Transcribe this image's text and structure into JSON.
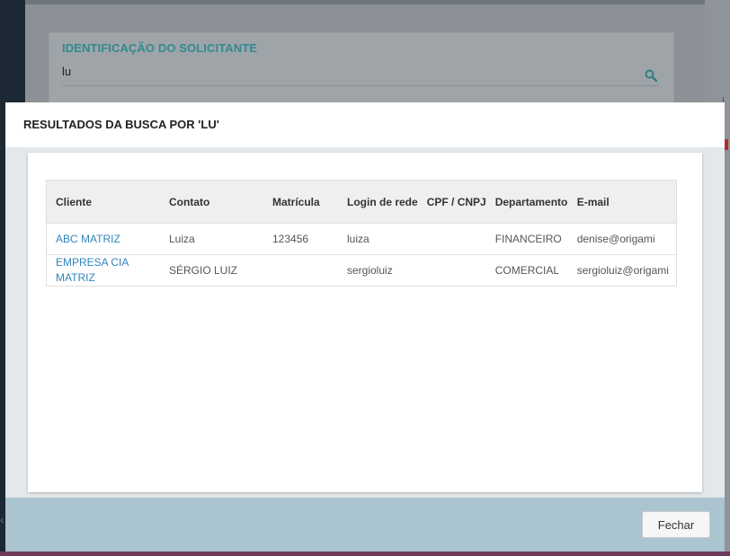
{
  "background_form": {
    "section_title": "IDENTIFICAÇÃO DO SOLICITANTE",
    "search_value": "lu",
    "search_icon": "search-icon"
  },
  "modal": {
    "title": "RESULTADOS DA BUSCA POR 'LU'",
    "columns": [
      "Cliente",
      "Contato",
      "Matrícula",
      "Login de rede",
      "CPF / CNPJ",
      "Departamento",
      "E-mail"
    ],
    "rows": [
      {
        "cliente": "ABC MATRIZ",
        "contato": "Luiza",
        "matricula": "123456",
        "login": "luiza",
        "cpf_cnpj": "",
        "departamento": "FINANCEIRO",
        "email": "denise@origami"
      },
      {
        "cliente": "EMPRESA CIA MATRIZ",
        "contato": "SÉRGIO LUIZ",
        "matricula": "",
        "login": "sergioluiz",
        "cpf_cnpj": "",
        "departamento": "COMERCIAL",
        "email": "sergioluiz@origami"
      }
    ],
    "close_label": "Fechar"
  },
  "colors": {
    "accent_teal": "#2f8a91",
    "link_blue": "#2f86b9",
    "footer_bg": "#aac4d0"
  }
}
